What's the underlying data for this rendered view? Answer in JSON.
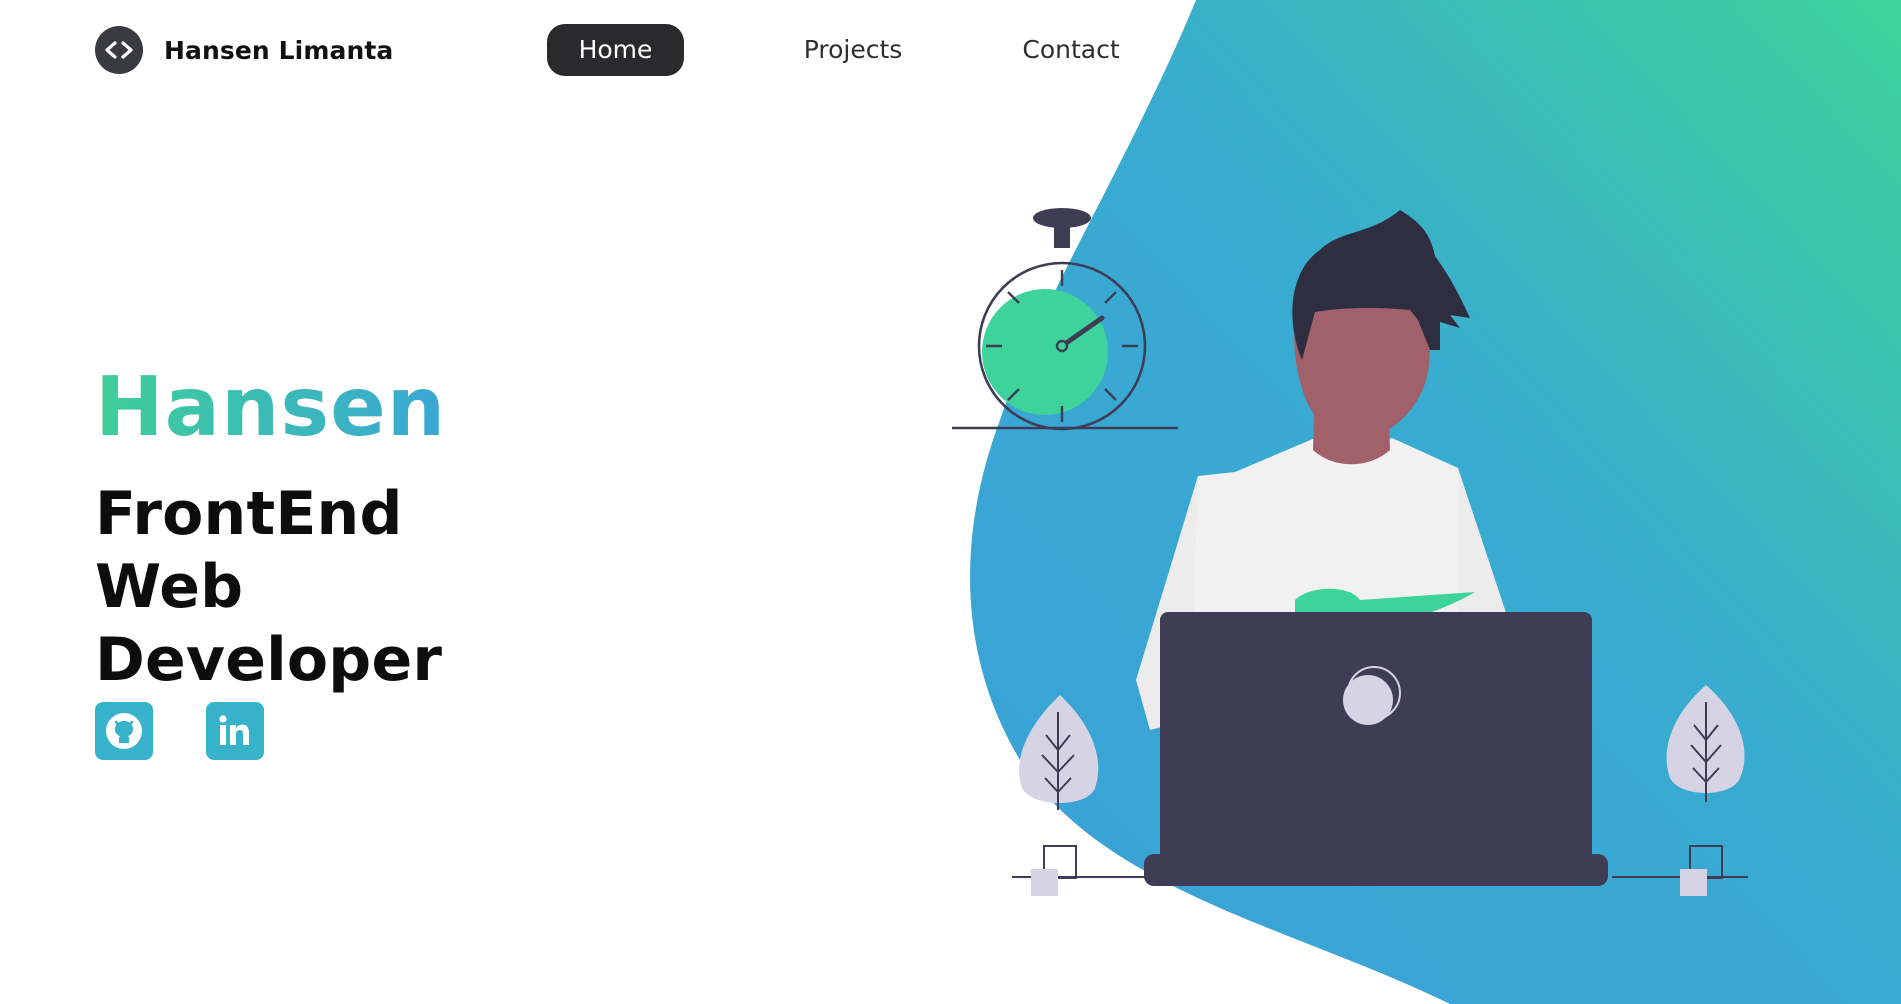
{
  "brand": {
    "name": "Hansen Limanta",
    "logo_icon": "code-brackets-icon"
  },
  "nav": {
    "items": [
      {
        "label": "Home",
        "active": true
      },
      {
        "label": "Projects",
        "active": false
      },
      {
        "label": "Contact",
        "active": false
      }
    ]
  },
  "hero": {
    "first_name": "Hansen",
    "role": "FrontEnd Web Developer"
  },
  "social": [
    {
      "icon": "github-icon"
    },
    {
      "icon": "linkedin-icon"
    }
  ],
  "colors": {
    "accent_green": "#3ecf98",
    "accent_blue": "#3aa7d5",
    "nav_active_bg": "#2a2a2c",
    "laptop": "#3f3d56",
    "social_bg": "#36b3ca"
  }
}
